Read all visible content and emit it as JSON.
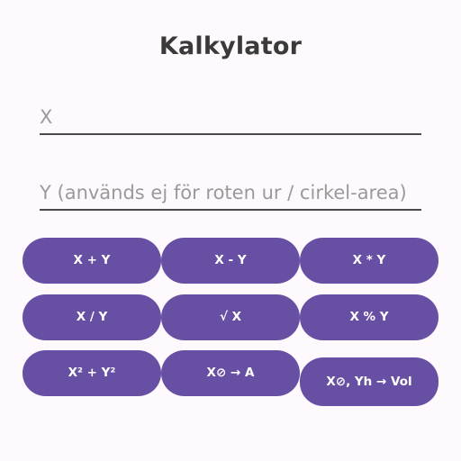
{
  "title": "Kalkylator",
  "inputs": {
    "x_placeholder": "X",
    "x_value": "",
    "y_placeholder": "Y (används ej för roten ur / cirkel-area)",
    "y_value": ""
  },
  "buttons": {
    "add": "X + Y",
    "subtract": "X - Y",
    "multiply": "X * Y",
    "divide": "X / Y",
    "sqrt": "√ X",
    "modulo": "X % Y",
    "sum_of_squares": "X² + Y²",
    "circle_area": "X⊘ → A",
    "cylinder_volume": "X⊘, Yh → Vol"
  },
  "colors": {
    "accent": "#6750a4",
    "background": "#fdf9fd",
    "button_text": "#ffffff"
  }
}
